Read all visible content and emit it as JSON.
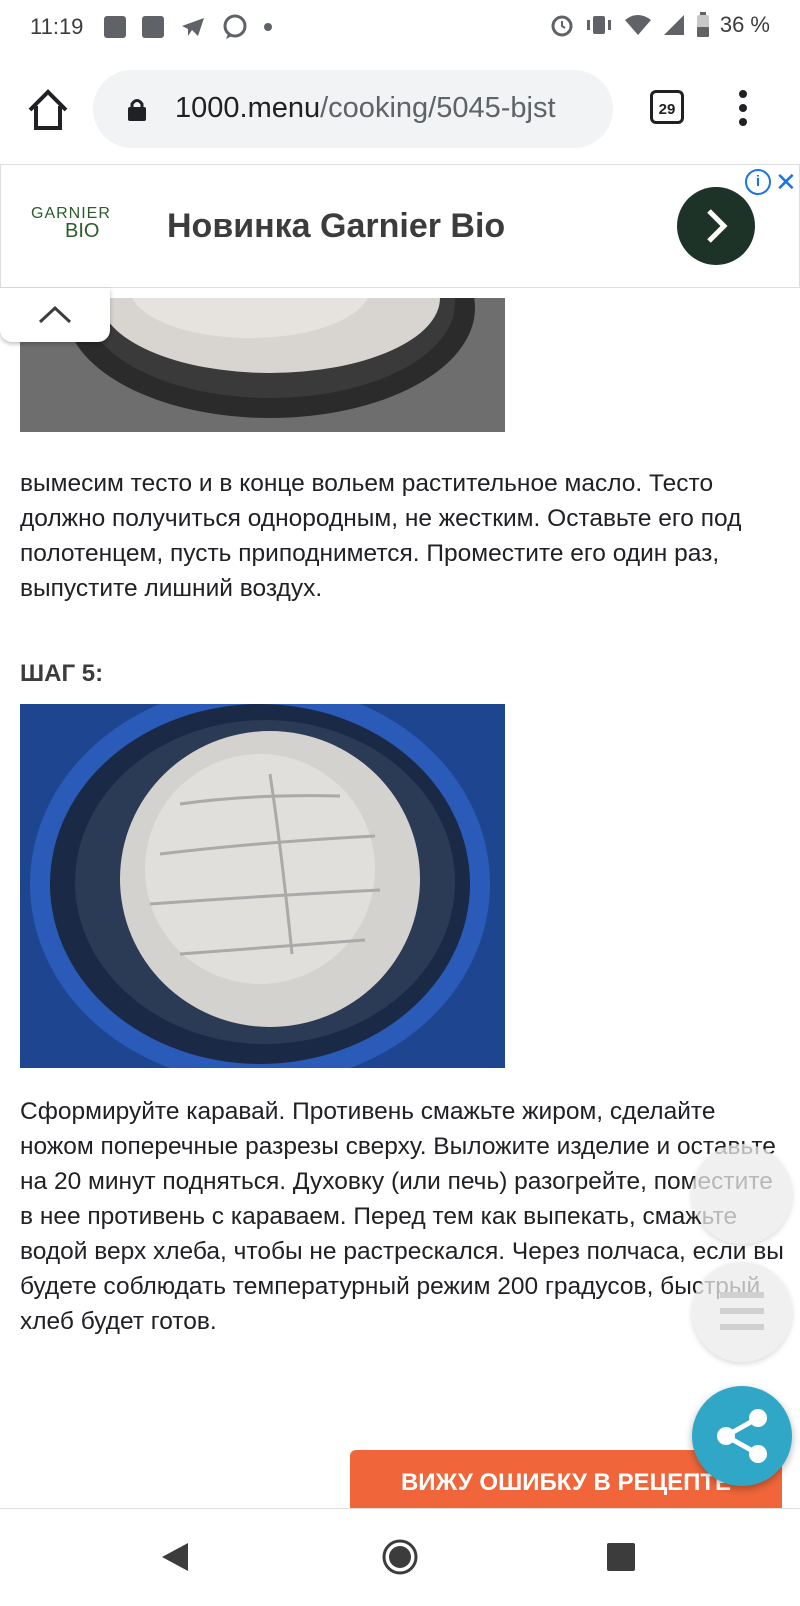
{
  "status_bar": {
    "time": "11:19",
    "battery": "36 %",
    "icons": [
      "image-icon",
      "news-icon",
      "telegram-icon",
      "viber-icon",
      "dot-icon",
      "alarm-icon",
      "vibrate-icon",
      "wifi-icon",
      "signal-icon",
      "battery-icon"
    ]
  },
  "browser": {
    "url_domain": "1000.menu",
    "url_path": "/cooking/5045-bjst",
    "tab_count": "29"
  },
  "ad": {
    "logo_top": "GARNIER",
    "logo_bottom": "BIO",
    "title": "Новинка Garnier Bio",
    "accent": "#1e3327"
  },
  "article": {
    "step4_text": "вымесим тесто и в конце вольем растительное масло. Тесто должно получиться однородным, не жестким. Оставьте его под полотенцем, пусть приподнимется. Проместите его один раз, выпустите лишний воздух.",
    "step5_label": "ШАГ 5:",
    "step5_text": "Сформируйте каравай. Противень смажьте жиром, сделайте ножом поперечные разрезы сверху. Выложите изделие и оставьте на 20 минут подняться. Духовку (или печь) разогрейте, поместите в нее противень с караваем. Перед тем как выпекать, смажьте водой верх хлеба, чтобы не растрескался. Через полчаса, если вы будете соблюдать температурный режим 200 градусов, быстрый хлеб будет готов."
  },
  "actions": {
    "report_error": "ВИЖУ ОШИБКУ В РЕЦЕПТЕ",
    "share_color": "#30a7c6",
    "error_color": "#f0663a"
  }
}
